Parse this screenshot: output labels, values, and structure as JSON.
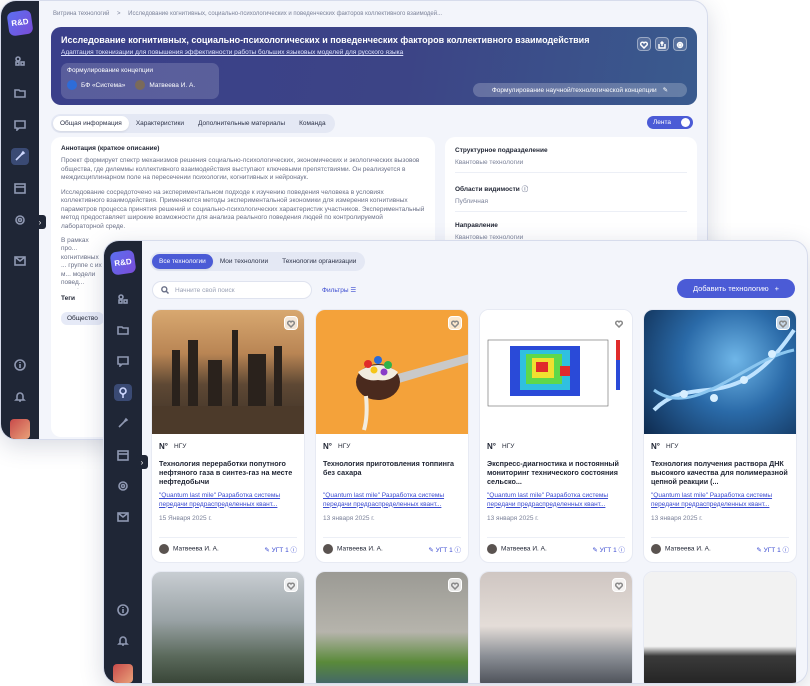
{
  "app": {
    "logo": "R&D"
  },
  "back": {
    "breadcrumb": {
      "root": "Витрина технологий",
      "sep": ">",
      "current": "Исследование когнитивных, социально-психологических и поведенческих факторов коллективного взаимодей..."
    },
    "title": "Исследование когнитивных, социально-психологических и поведенческих факторов коллективного взаимодействия",
    "subtitle": "Адаптация токенизации для повышения эффективности работы больших языковых моделей для русского языка",
    "concept": {
      "label": "Формулирование концепции",
      "org": "БФ «Система»",
      "person": "Матвеева И. А."
    },
    "concept_button": "Формулирование научной/технологической концепции",
    "tabs": [
      "Общая информация",
      "Характеристики",
      "Дополнительные материалы",
      "Команда"
    ],
    "feed_label": "Лента",
    "annotation_title": "Аннотация (краткое описание)",
    "annotation_p1": "Проект формирует спектр механизмов решения социально-психологических, экономических и экологических вызовов общества, где дилеммы коллективного взаимодействия выступают ключевыми препятствиями. Он реализуется в междисциплинарном поле на пересечении психологии, когнитивных и нейронаук.",
    "annotation_p2": "Исследование сосредоточено на экспериментальном подходе к изучению поведения человека в условиях коллективного взаимодействия. Применяются методы экспериментальной экономики для измерения когнитивных параметров процесса принятия решений и социально-психологических характеристик участников. Экспериментальный метод предоставляет широкие возможности для анализа реального поведения людей по контролируемой лабораторной среде.",
    "annotation_p3": "В рамках про... когнитивных ... группе с их м... модели повед... верификации ... коллективног...",
    "tags_title": "Теги",
    "tag": "Общество",
    "fields": [
      {
        "label": "Структурное подразделение",
        "value": "Квантовые технологии"
      },
      {
        "label": "Области видимости",
        "value": "Публичная"
      },
      {
        "label": "Направление",
        "value": "Квантовые технологии"
      }
    ]
  },
  "front": {
    "tabs": [
      "Все технологии",
      "Мои технологии",
      "Технологии организации"
    ],
    "search_placeholder": "Начните свой поиск",
    "filters": "Фильтры",
    "add_button": "Добавить технологию",
    "cards": [
      {
        "org": "НГУ",
        "title": "Технология переработки попутного нефтяного газа в синтез-газ на месте нефтедобычи",
        "link": "\"Quantum last mile\" Разработка системы передачи предраспределенных квант...",
        "date": "15 Января 2025 г.",
        "author": "Матвеева И. А.",
        "ugt": "УГТ 1"
      },
      {
        "org": "НГУ",
        "title": "Технология приготовления топпинга без сахара",
        "link": "\"Quantum last mile\" Разработка системы передачи предраспределенных квант...",
        "date": "13 января 2025 г.",
        "author": "Матвеева И. А.",
        "ugt": "УГТ 1"
      },
      {
        "org": "НГУ",
        "title": "Экспресс-диагностика и постоянный мониторинг технического состояния сельско...",
        "link": "\"Quantum last mile\" Разработка системы передачи предраспределенных квант...",
        "date": "13 января 2025 г.",
        "author": "Матвеева И. А.",
        "ugt": "УГТ 1"
      },
      {
        "org": "НГУ",
        "title": "Технология получения раствора ДНК высокого качества для полимеразной цепной реакции (...",
        "link": "\"Quantum last mile\" Разработка системы передачи предраспределенных квант...",
        "date": "13 января 2025 г.",
        "author": "Матвеева И. А.",
        "ugt": "УГТ 1"
      }
    ]
  }
}
